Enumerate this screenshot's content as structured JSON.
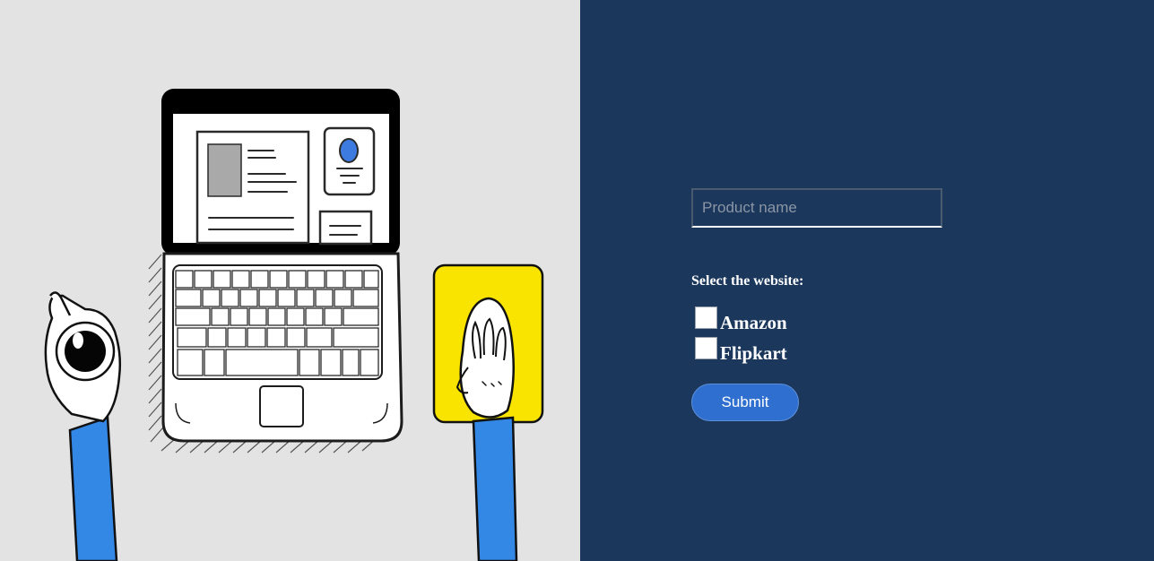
{
  "colors": {
    "left_background": "#e3e3e3",
    "right_background": "#1b375c",
    "accent_button": "#2f6fcf",
    "arm_blue": "#3388e6",
    "mousepad_yellow": "#f9e400"
  },
  "illustration": {
    "icon": "laptop-desk-illustration"
  },
  "form": {
    "product_placeholder": "Product name",
    "product_value": "",
    "select_label": "Select the website:",
    "options": [
      {
        "label": "Amazon",
        "checked": false
      },
      {
        "label": "Flipkart",
        "checked": false
      }
    ],
    "submit_label": "Submit"
  }
}
